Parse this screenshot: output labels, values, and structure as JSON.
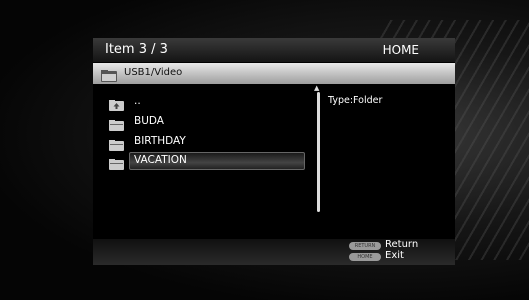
{
  "header": {
    "item_count": "Item 3 / 3",
    "home_title": "HOME"
  },
  "path": {
    "label": "USB1/Video",
    "icon": "folder-icon"
  },
  "list": {
    "items": [
      {
        "label": "..",
        "icon": "folder-up-icon"
      },
      {
        "label": "BUDA",
        "icon": "folder-icon"
      },
      {
        "label": "BIRTHDAY",
        "icon": "folder-icon"
      },
      {
        "label": "VACATION",
        "icon": "folder-icon",
        "selected": true
      }
    ]
  },
  "info": {
    "type_text": "Type:Folder"
  },
  "footer": {
    "return_key": "RETURN",
    "return_label": "Return",
    "home_key": "HOME",
    "exit_label": "Exit"
  }
}
